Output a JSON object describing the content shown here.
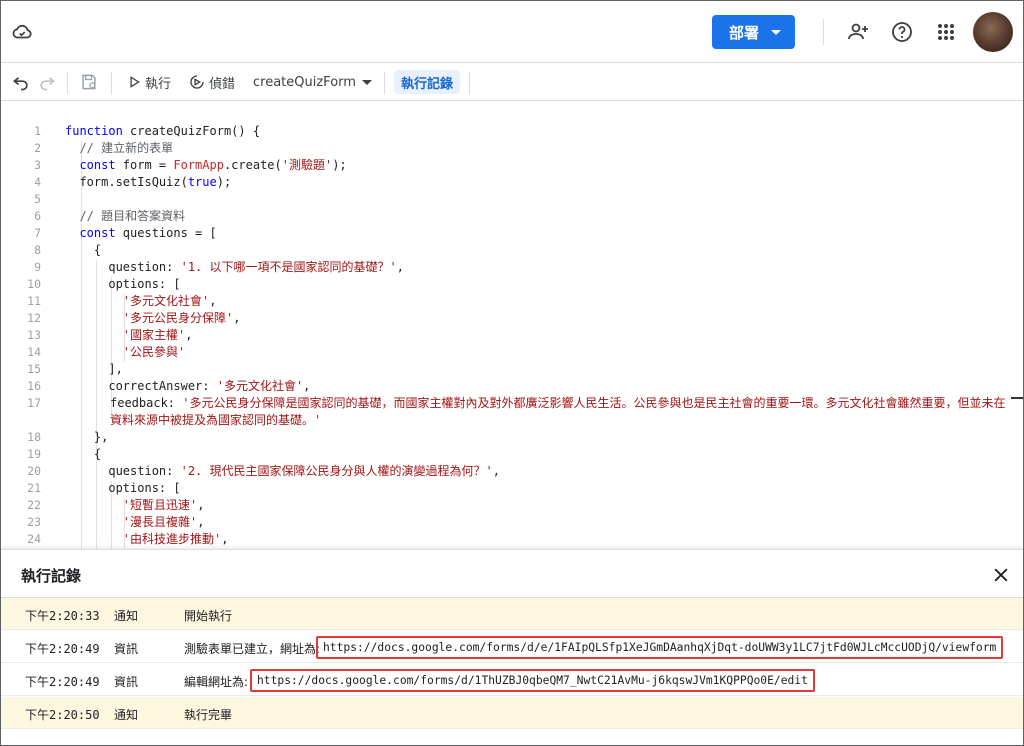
{
  "header": {
    "deploy_label": "部署"
  },
  "toolbar": {
    "run_label": "執行",
    "debug_label": "偵錯",
    "function_name": "createQuizForm",
    "log_label": "執行記錄"
  },
  "editor": {
    "lines": [
      {
        "n": "1",
        "text": "function createQuizForm() {"
      },
      {
        "n": "2",
        "text": "  // 建立新的表單"
      },
      {
        "n": "3",
        "text": "  const form = FormApp.create('測驗題');"
      },
      {
        "n": "4",
        "text": "  form.setIsQuiz(true);"
      },
      {
        "n": "5",
        "text": ""
      },
      {
        "n": "6",
        "text": "  // 題目和答案資料"
      },
      {
        "n": "7",
        "text": "  const questions = ["
      },
      {
        "n": "8",
        "text": "    {"
      },
      {
        "n": "9",
        "text": "      question: '1. 以下哪一項不是國家認同的基礎？',"
      },
      {
        "n": "10",
        "text": "      options: ["
      },
      {
        "n": "11",
        "text": "        '多元文化社會',"
      },
      {
        "n": "12",
        "text": "        '多元公民身分保障',"
      },
      {
        "n": "13",
        "text": "        '國家主權',"
      },
      {
        "n": "14",
        "text": "        '公民參與'"
      },
      {
        "n": "15",
        "text": "      ],"
      },
      {
        "n": "16",
        "text": "      correctAnswer: '多元文化社會',"
      },
      {
        "n": "17",
        "text": "      feedback: '多元公民身分保障是國家認同的基礎，而國家主權對內及對外都廣泛影響人民生活。公民參與也是民主社會的重要一環。多元文化社會雖然重要，但並未在資料來源中被提及為國家認同的基礎。'"
      },
      {
        "n": "18",
        "text": "    },"
      },
      {
        "n": "19",
        "text": "    {"
      },
      {
        "n": "20",
        "text": "      question: '2. 現代民主國家保障公民身分與人權的演變過程為何？',"
      },
      {
        "n": "21",
        "text": "      options: ["
      },
      {
        "n": "22",
        "text": "        '短暫且迅速',"
      },
      {
        "n": "23",
        "text": "        '漫長且複雜',"
      },
      {
        "n": "24",
        "text": "        '由科技進步推動',"
      }
    ]
  },
  "log": {
    "title": "執行記錄",
    "rows": [
      {
        "time": "下午2:20:33",
        "level": "通知",
        "message": "開始執行",
        "url": ""
      },
      {
        "time": "下午2:20:49",
        "level": "資訊",
        "message": "測驗表單已建立，網址為:",
        "url": "https://docs.google.com/forms/d/e/1FAIpQLSfp1XeJGmDAanhqXjDqt-doUWW3y1LC7jtFd0WJLcMccUODjQ/viewform"
      },
      {
        "time": "下午2:20:49",
        "level": "資訊",
        "message": "編輯網址為:",
        "url": "https://docs.google.com/forms/d/1ThUZBJ0qbeQM7_NwtC21AvMu-j6kqswJVm1KQPPQo0E/edit"
      },
      {
        "time": "下午2:20:50",
        "level": "通知",
        "message": "執行完畢",
        "url": ""
      }
    ]
  }
}
